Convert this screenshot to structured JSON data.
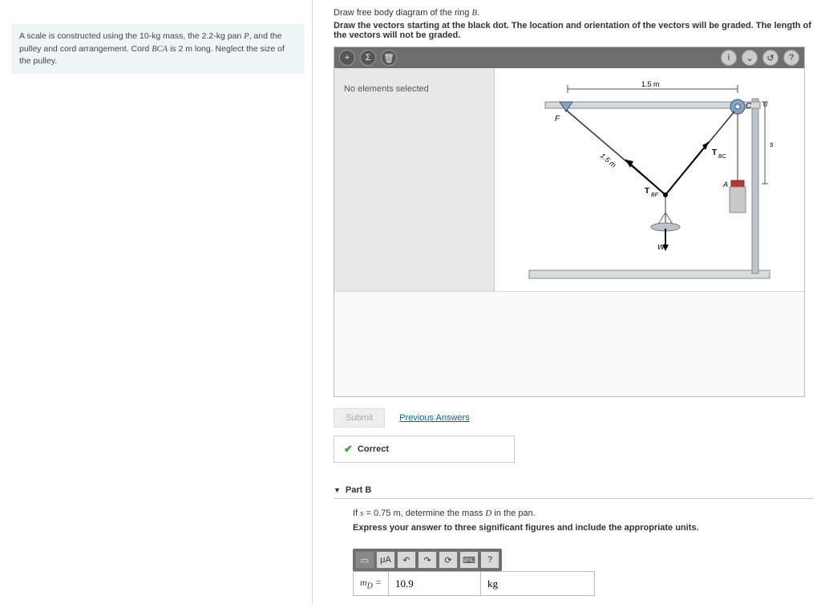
{
  "setup": {
    "text_before_P": "A scale is constructed using the 10-kg mass, the 2.2-kg pan ",
    "P": "P",
    "text_mid": ", and the pulley and cord arrangement. Cord ",
    "BCA": "BCA",
    "text_after": " is 2 m long. Neglect the size of the pulley."
  },
  "partA": {
    "instruct1_pre": "Draw free body diagram of the ring ",
    "instruct1_var": "B",
    "instruct1_post": ".",
    "instruct2": "Draw the vectors starting at the black dot. The location and orientation of the vectors will be graded. The length of the vectors will not be graded.",
    "no_elements": "No elements selected",
    "submit": "Submit",
    "prev": "Previous Answers",
    "correct": "Correct"
  },
  "fig": {
    "dim_top": "1.5 m",
    "dim_cord": "1.5 m",
    "F": "F",
    "C": "C",
    "zero": "0",
    "s": "s",
    "A": "A",
    "W": "W",
    "Tbc": "T_BC",
    "Tbf": "T_BF"
  },
  "partB": {
    "title": "Part B",
    "prompt_pre": "If ",
    "prompt_var": "s",
    "prompt_mid": " = 0.75 m, determine the mass ",
    "prompt_var2": "D",
    "prompt_post": " in the pan.",
    "express": "Express your answer to three significant figures and include the appropriate units.",
    "md_label": "m_D =",
    "value": "10.9",
    "unit": "kg",
    "muA": "μA",
    "question": "?"
  },
  "icons": {
    "plus": "+",
    "sigma": "Σ",
    "trash": "🗑",
    "info": "i",
    "down": "⌄",
    "reset": "↺",
    "help": "?",
    "frac": "▭",
    "undo": "↶",
    "redo": "↷",
    "refresh": "⟳",
    "keyb": "⌨"
  }
}
